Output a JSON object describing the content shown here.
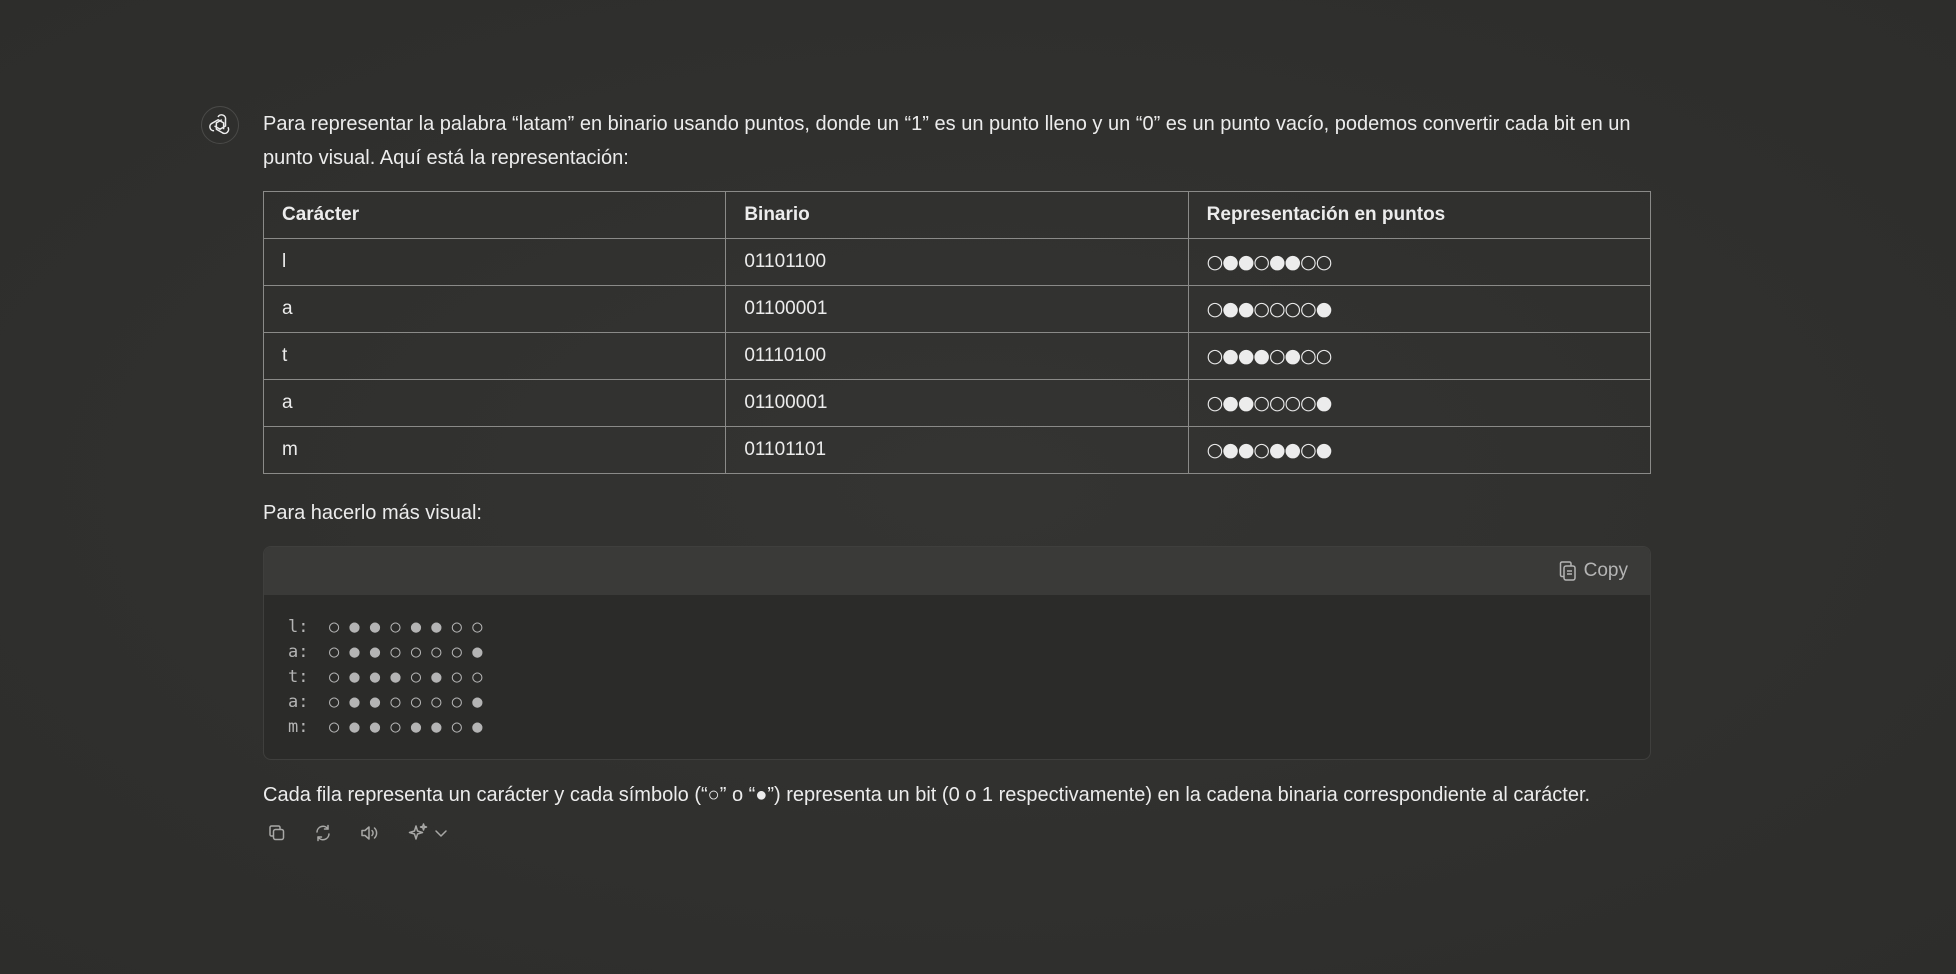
{
  "message": {
    "intro": "Para representar la palabra “latam” en binario usando puntos, donde un “1” es un punto lleno y un “0” es un punto vacío, podemos convertir cada bit en un punto visual. Aquí está la representación:",
    "table": {
      "headers": [
        "Carácter",
        "Binario",
        "Representación en puntos"
      ],
      "rows": [
        {
          "char": "l",
          "binary": "01101100",
          "dots": "○●●○●●○○"
        },
        {
          "char": "a",
          "binary": "01100001",
          "dots": "○●●○○○○●"
        },
        {
          "char": "t",
          "binary": "01110100",
          "dots": "○●●●○●○○"
        },
        {
          "char": "a",
          "binary": "01100001",
          "dots": "○●●○○○○●"
        },
        {
          "char": "m",
          "binary": "01101101",
          "dots": "○●●○●●○●"
        }
      ]
    },
    "visual_heading": "Para hacerlo más visual:",
    "code": {
      "copy_label": "Copy",
      "lines": [
        "l:  ○ ● ● ○ ● ● ○ ○",
        "a:  ○ ● ● ○ ○ ○ ○ ●",
        "t:  ○ ● ● ● ○ ● ○ ○",
        "a:  ○ ● ● ○ ○ ○ ○ ●",
        "m:  ○ ● ● ○ ● ● ○ ●"
      ]
    },
    "conclusion": "Cada fila representa un carácter y cada símbolo (“○” o “●”) representa un bit (0 o 1 respectivamente) en la cadena binaria correspondiente al carácter."
  },
  "icons": {
    "avatar": "openai-logo-icon",
    "copy": "copy-icon",
    "actions": [
      "copy-icon",
      "regenerate-icon",
      "read-aloud-icon",
      "sparkle-icon",
      "chevron-down-icon"
    ]
  },
  "colors": {
    "background": "#2f2f2d",
    "text": "#ececec",
    "code_header": "#3a3a38",
    "table_border": "#8a8a88"
  }
}
